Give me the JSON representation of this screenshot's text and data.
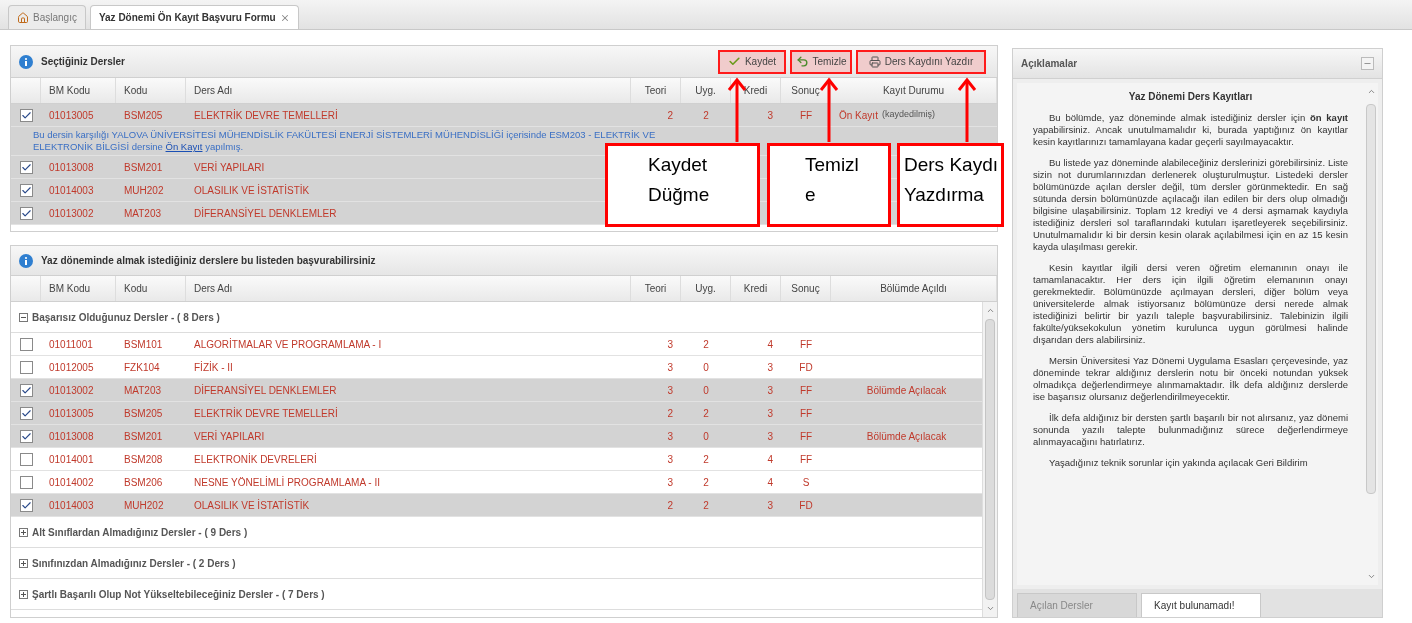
{
  "tabs": [
    {
      "label": "Başlangıç",
      "selected": false,
      "closable": false
    },
    {
      "label": "Yaz Dönemi Ön Kayıt Başvuru Formu",
      "selected": true,
      "closable": true
    }
  ],
  "selected_panel": {
    "title": "Seçtiğiniz Dersler",
    "buttons": [
      {
        "label": "Kaydet",
        "kind": "save"
      },
      {
        "label": "Temizle",
        "kind": "clear"
      },
      {
        "label": "Ders Kaydını Yazdır",
        "kind": "print"
      }
    ],
    "columns": [
      "BM Kodu",
      "Kodu",
      "Ders Adı",
      "Teori",
      "Uyg.",
      "Kredi",
      "Sonuç",
      "Kayıt Durumu"
    ],
    "rows": [
      {
        "checked": true,
        "bm_code": "01013005",
        "code": "BSM205",
        "name": "ELEKTRİK DEVRE TEMELLERİ",
        "theory": "2",
        "practice": "2",
        "credit": "3",
        "result": "FF",
        "status": "Ön Kayıt",
        "status_note": "(kaydedilmiş)",
        "note": {
          "before": "Bu dersin karşılığı YALOVA ÜNİVERSİTESİ MÜHENDİSLİK FAKÜLTESİ ENERJİ SİSTEMLERİ MÜHENDİSLİĞİ içerisinde ESM203 - ELEKTRİK VE ELEKTRONİK BİLGİSİ dersine",
          "link": "Ön Kayıt",
          "after": "yapılmış."
        }
      },
      {
        "checked": true,
        "bm_code": "01013008",
        "code": "BSM201",
        "name": "VERİ YAPILARI"
      },
      {
        "checked": true,
        "bm_code": "01014003",
        "code": "MUH202",
        "name": "OLASILIK VE İSTATİSTİK"
      },
      {
        "checked": true,
        "bm_code": "01013002",
        "code": "MAT203",
        "name": "DİFERANSİYEL DENKLEMLER"
      }
    ]
  },
  "course_list": {
    "title": "Yaz döneminde almak istediğiniz derslere bu listeden başvurabilirsiniz",
    "columns": [
      "BM Kodu",
      "Kodu",
      "Ders Adı",
      "Teori",
      "Uyg.",
      "Kredi",
      "Sonuç",
      "Bölümde Açıldı"
    ],
    "groups": [
      {
        "label": "Başarısız Olduğunuz Dersler - ( 8 Ders )",
        "expanded": true,
        "rows": [
          {
            "checked": false,
            "bm_code": "01011001",
            "code": "BSM101",
            "name": "ALGORİTMALAR VE PROGRAMLAMA - I",
            "theory": "3",
            "practice": "2",
            "credit": "4",
            "result": "FF"
          },
          {
            "checked": false,
            "bm_code": "01012005",
            "code": "FZK104",
            "name": "FİZİK - II",
            "theory": "3",
            "practice": "0",
            "credit": "3",
            "result": "FD"
          },
          {
            "checked": true,
            "bm_code": "01013002",
            "code": "MAT203",
            "name": "DİFERANSİYEL DENKLEMLER",
            "theory": "3",
            "practice": "0",
            "credit": "3",
            "result": "FF",
            "opened": "Bölümde Açılacak"
          },
          {
            "checked": true,
            "bm_code": "01013005",
            "code": "BSM205",
            "name": "ELEKTRİK DEVRE TEMELLERİ",
            "theory": "2",
            "practice": "2",
            "credit": "3",
            "result": "FF"
          },
          {
            "checked": true,
            "bm_code": "01013008",
            "code": "BSM201",
            "name": "VERİ YAPILARI",
            "theory": "3",
            "practice": "0",
            "credit": "3",
            "result": "FF",
            "opened": "Bölümde Açılacak"
          },
          {
            "checked": false,
            "bm_code": "01014001",
            "code": "BSM208",
            "name": "ELEKTRONİK DEVRELERİ",
            "theory": "3",
            "practice": "2",
            "credit": "4",
            "result": "FF"
          },
          {
            "checked": false,
            "bm_code": "01014002",
            "code": "BSM206",
            "name": "NESNE YÖNELİMLİ PROGRAMLAMA - II",
            "theory": "3",
            "practice": "2",
            "credit": "4",
            "result": "S"
          },
          {
            "checked": true,
            "bm_code": "01014003",
            "code": "MUH202",
            "name": "OLASILIK VE İSTATİSTİK",
            "theory": "2",
            "practice": "2",
            "credit": "3",
            "result": "FD"
          }
        ]
      },
      {
        "label": "Alt Sınıflardan Almadığınız Dersler - ( 9 Ders )",
        "expanded": false
      },
      {
        "label": "Sınıfınızdan Almadığınız Dersler - ( 2 Ders )",
        "expanded": false
      },
      {
        "label": "Şartlı Başarılı Olup Not Yükseltebileceğiniz Dersler - ( 7 Ders )",
        "expanded": false
      }
    ]
  },
  "notes": {
    "title": "Açıklamalar",
    "heading": "Yaz Dönemi Ders Kayıtları",
    "paragraphs": [
      "Bu bölümde, yaz döneminde almak istediğiniz dersler için **ön kayıt** yapabilirsiniz. Ancak unutulmamalıdır ki, burada yaptığınız ön kayıtlar kesin kayıtlarınızı tamamlayana kadar geçerli sayılmayacaktır.",
      "Bu listede yaz döneminde alabileceğiniz derslerinizi görebilirsiniz. Liste sizin not durumlarınızdan derlenerek oluşturulmuştur. Listedeki dersler bölümünüzde açılan dersler değil, tüm dersler görünmektedir. En sağ sütunda dersin bölümünüzde açılacağı ilan edilen bir ders olup olmadığı bilgisine ulaşabilirsiniz. Toplam 12 krediyi ve 4 dersi aşmamak kaydıyla istediğiniz dersleri sol taraflarındaki kutuları işaretleyerek seçebilirsiniz. Unutulmamalıdır ki bir dersin kesin olarak açılabilmesi için en az 15 kesin kayda ulaşılması gerekir.",
      "Kesin kayıtlar ilgili dersi veren öğretim elemanının onayı ile tamamlanacaktır. Her ders için ilgili öğretim elemanının onayı gerekmektedir. Bölümünüzde açılmayan dersleri, diğer bölüm veya üniversitelerde almak istiyorsanız bölümünüze dersi nerede almak istediğinizi belirtir bir yazılı taleple başvurabilirsiniz. Talebinizin ilgili fakülte/yüksekokulun yönetim kurulunca uygun görülmesi halinde dışarıdan ders alabilirsiniz.",
      "Mersin Üniversitesi Yaz Dönemi Uygulama Esasları çerçevesinde, yaz döneminde tekrar aldığınız derslerin notu bir önceki notundan yüksek olmadıkça değerlendirmeye alınmamaktadır. İlk defa aldığınız derslerde ise başarısız olursanız değerlendirilmeyecektir.",
      "İlk defa aldığınız bir dersten şartlı başarılı bir not alırsanız, yaz dönemi sonunda yazılı talepte bulunmadığınız sürece değerlendirmeye alınmayacağını hatırlatırız.",
      "Yaşadığınız teknik sorunlar için yakında açılacak Geri Bildirim"
    ],
    "tabs": [
      {
        "label": "Açılan Dersler",
        "selected": false
      },
      {
        "label": "Kayıt bulunamadı!",
        "selected": true
      }
    ]
  },
  "callouts": [
    {
      "text": "Kaydet\nDüğme"
    },
    {
      "text": "Temizl\ne"
    },
    {
      "text": "Ders Kaydı\nYazdırma"
    }
  ]
}
